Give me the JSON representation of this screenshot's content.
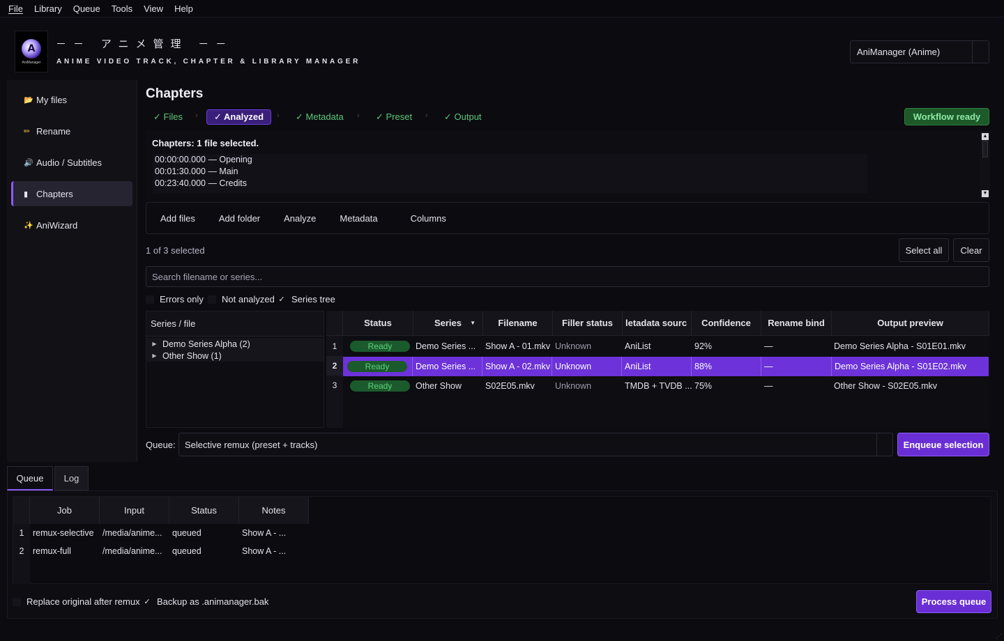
{
  "menu": [
    "File",
    "Library",
    "Queue",
    "Tools",
    "View",
    "Help"
  ],
  "header": {
    "logo_text": "AniManager",
    "jp_title": "－－ アニメ管理 －－",
    "subtitle": "ANIME VIDEO TRACK, CHAPTER & LIBRARY MANAGER",
    "profile": "AniManager (Anime)"
  },
  "sidebar": {
    "items": [
      {
        "label": "My files",
        "icon": "folder-icon"
      },
      {
        "label": "Rename",
        "icon": "pencil-icon"
      },
      {
        "label": "Audio / Subtitles",
        "icon": "speaker-icon"
      },
      {
        "label": "Chapters",
        "icon": "document-icon"
      },
      {
        "label": "AniWizard",
        "icon": "sparkle-icon"
      }
    ],
    "active": "Chapters"
  },
  "main": {
    "title": "Chapters",
    "steps": [
      {
        "label": "✓ Files",
        "state": "done"
      },
      {
        "label": "✓ Analyzed",
        "state": "active"
      },
      {
        "label": "✓ Metadata",
        "state": "done"
      },
      {
        "label": "✓ Preset",
        "state": "done"
      },
      {
        "label": "✓ Output",
        "state": "done"
      }
    ],
    "workflow_status": "Workflow ready",
    "chapters": {
      "heading": "Chapters: 1 file selected.",
      "lines": [
        "00:00:00.000 — Opening",
        "00:01:30.000 — Main",
        "00:23:40.000 — Credits"
      ]
    },
    "toolbar": [
      "Add files",
      "Add folder",
      "Analyze",
      "Metadata",
      "Columns"
    ],
    "selection_count": "1 of 3 selected",
    "select_all_label": "Select all",
    "clear_label": "Clear",
    "search_placeholder": "Search filename or series...",
    "filters": [
      {
        "label": "Errors only",
        "checked": false
      },
      {
        "label": "Not analyzed",
        "checked": false
      },
      {
        "label": "Series tree",
        "checked": true
      }
    ],
    "tree": {
      "header": "Series / file",
      "rows": [
        "Demo Series Alpha (2)",
        "Other Show (1)"
      ]
    },
    "grid": {
      "columns": [
        "Status",
        "Series",
        "Filename",
        "Filler status",
        "Metadata source",
        "Confidence",
        "Rename bind",
        "Output preview"
      ],
      "column_headers_visible": [
        "Status",
        "Series",
        "Filename",
        "Filler status",
        "letadata sourc",
        "Confidence",
        "Rename bind",
        "Output preview"
      ],
      "rows": [
        {
          "num": "1",
          "status": "Ready",
          "series": "Demo Series ...",
          "filename": "Show A - 01.mkv",
          "filler": "Unknown",
          "source": "AniList",
          "confidence": "92%",
          "bind": "—",
          "output": "Demo Series Alpha - S01E01.mkv",
          "selected": false
        },
        {
          "num": "2",
          "status": "Ready",
          "series": "Demo Series ...",
          "filename": "Show A - 02.mkv",
          "filler": "Unknown",
          "source": "AniList",
          "confidence": "88%",
          "bind": "—",
          "output": "Demo Series Alpha - S01E02.mkv",
          "selected": true
        },
        {
          "num": "3",
          "status": "Ready",
          "series": "Other Show",
          "filename": "S02E05.mkv",
          "filler": "Unknown",
          "source": "TMDB + TVDB ...",
          "confidence": "75%",
          "bind": "—",
          "output": "Other Show - S02E05.mkv",
          "selected": false
        }
      ]
    },
    "queue_label": "Queue:",
    "queue_preset": "Selective remux (preset + tracks)",
    "enqueue_label": "Enqueue selection"
  },
  "dock": {
    "tabs": [
      "Queue",
      "Log"
    ],
    "active_tab": "Queue",
    "columns": [
      "Job",
      "Input",
      "Status",
      "Notes"
    ],
    "rows": [
      {
        "num": "1",
        "job": "remux-selective",
        "input": "/media/anime...",
        "status": "queued",
        "notes": "Show A - ..."
      },
      {
        "num": "2",
        "job": "remux-full",
        "input": "/media/anime...",
        "status": "queued",
        "notes": "Show A - ..."
      }
    ],
    "options": [
      {
        "label": "Replace original after remux",
        "checked": false
      },
      {
        "label": "Backup as .animanager.bak",
        "checked": true
      }
    ],
    "process_label": "Process queue"
  },
  "colors": {
    "accent": "#6a2fd4",
    "success": "#5fd17e",
    "background": "#0c0b10"
  }
}
